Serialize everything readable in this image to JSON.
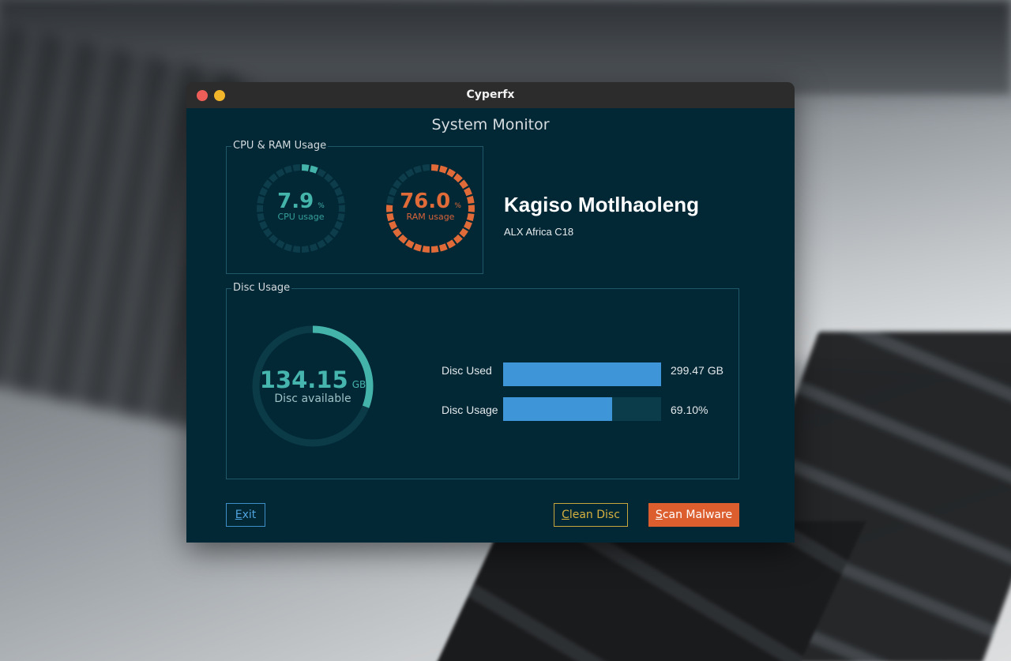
{
  "window": {
    "title": "Cyperfx",
    "app_title": "System Monitor"
  },
  "cpu_ram_group": {
    "label": "CPU & RAM Usage",
    "cpu": {
      "value": "7.9",
      "unit": "%",
      "caption": "CPU usage",
      "percent": 7.9,
      "color": "#44b3aa"
    },
    "ram": {
      "value": "76.0",
      "unit": "%",
      "caption": "RAM usage",
      "percent": 76.0,
      "color": "#e06a38"
    }
  },
  "user": {
    "name": "Kagiso Motlhaoleng",
    "subtitle": "ALX Africa C18"
  },
  "disc_group": {
    "label": "Disc Usage",
    "available": {
      "value": "134.15",
      "unit": "GB",
      "caption": "Disc available",
      "fraction": 0.309
    },
    "bars": [
      {
        "label": "Disc Used",
        "value": "299.47 GB",
        "fill": 1.0
      },
      {
        "label": "Disc Usage",
        "value": "69.10%",
        "fill": 0.691
      }
    ]
  },
  "buttons": {
    "exit": {
      "mnemonic": "E",
      "rest": "xit"
    },
    "clean": {
      "mnemonic": "C",
      "rest": "lean Disc"
    },
    "scan": {
      "mnemonic": "S",
      "rest": "can Malware"
    }
  },
  "colors": {
    "background": "#022735",
    "accent_teal": "#44b3aa",
    "accent_orange": "#e06a38",
    "bar_blue": "#3e95d8"
  }
}
